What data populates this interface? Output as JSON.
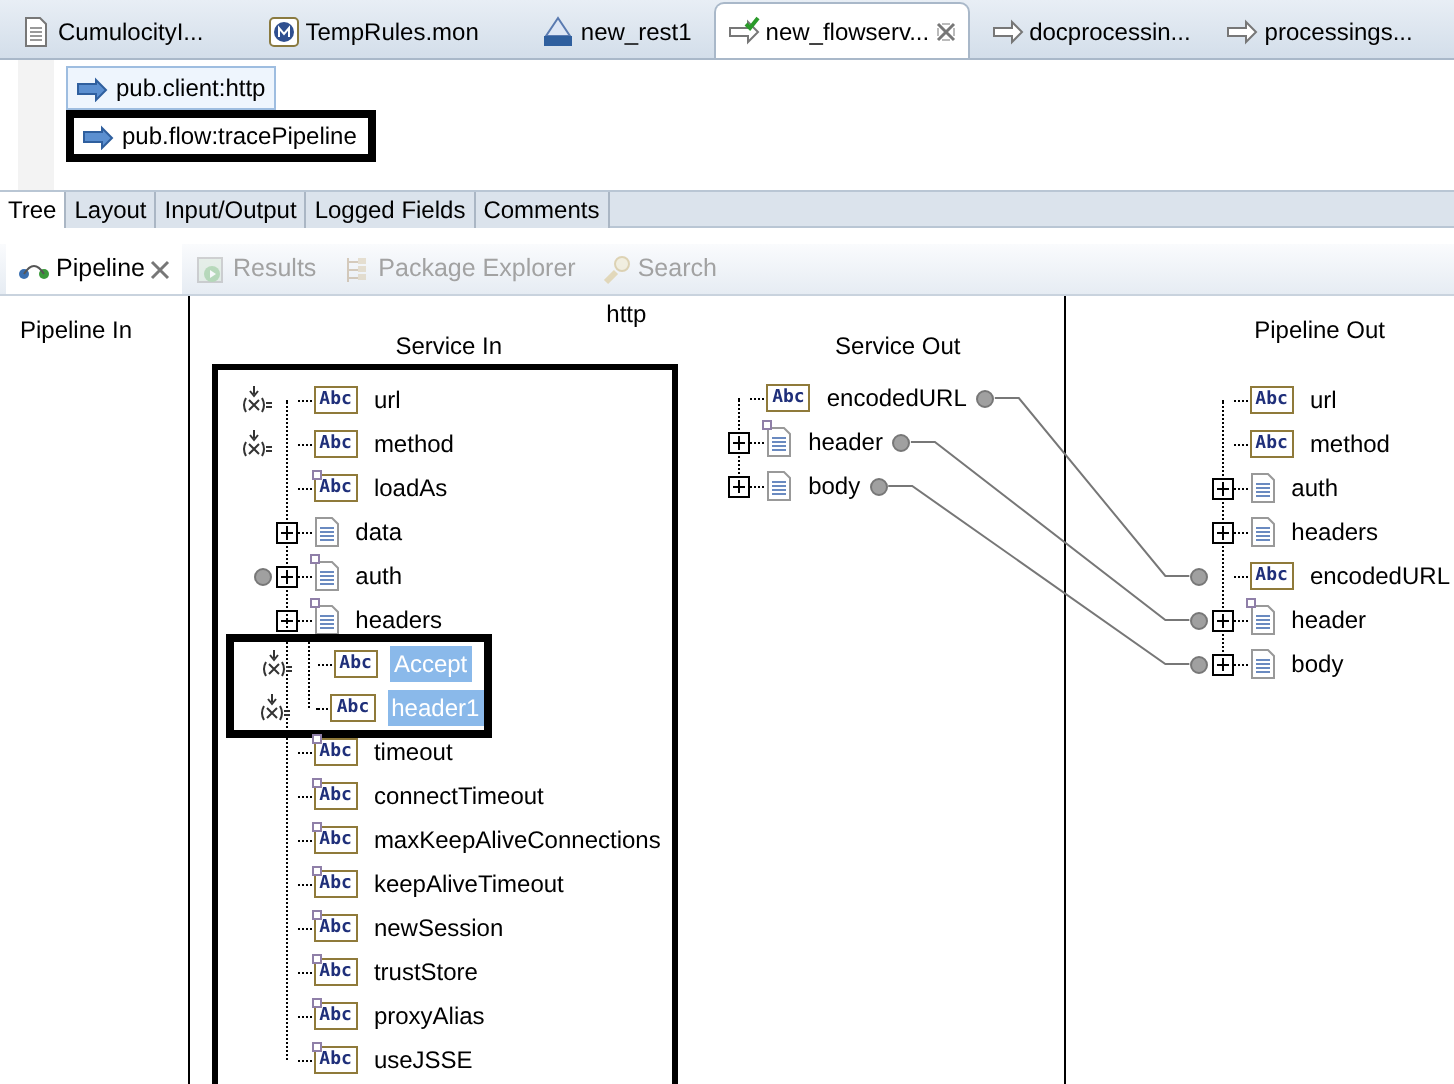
{
  "editor_tabs": [
    {
      "label": "CumulocityI...",
      "kind": "document",
      "selected": false,
      "closable": false
    },
    {
      "label": "TempRules.mon",
      "kind": "monitor",
      "selected": false,
      "closable": false
    },
    {
      "label": "new_rest1",
      "kind": "rest",
      "selected": false,
      "closable": false
    },
    {
      "label": "new_flowserv...",
      "kind": "flow-checked",
      "selected": true,
      "closable": true
    },
    {
      "label": "docprocessin...",
      "kind": "flow",
      "selected": false,
      "closable": false
    },
    {
      "label": "processings...",
      "kind": "flow",
      "selected": false,
      "closable": false
    }
  ],
  "flow_steps": [
    {
      "label": "pub.client:http",
      "selected": true,
      "outlined": false
    },
    {
      "label": "pub.flow:tracePipeline",
      "selected": false,
      "outlined": true
    }
  ],
  "editor_subtabs": [
    {
      "label": "Tree",
      "selected": true
    },
    {
      "label": "Layout",
      "selected": false
    },
    {
      "label": "Input/Output",
      "selected": false
    },
    {
      "label": "Logged Fields",
      "selected": false
    },
    {
      "label": "Comments",
      "selected": false
    }
  ],
  "view_tabs": [
    {
      "label": "Pipeline",
      "kind": "pipeline",
      "selected": true,
      "disabled": false,
      "closable": true
    },
    {
      "label": "Results",
      "kind": "results",
      "selected": false,
      "disabled": true,
      "closable": false
    },
    {
      "label": "Package Explorer",
      "kind": "packages",
      "selected": false,
      "disabled": true,
      "closable": false
    },
    {
      "label": "Search",
      "kind": "search",
      "selected": false,
      "disabled": true,
      "closable": false
    }
  ],
  "pipeline": {
    "pipeline_in": {
      "title": "Pipeline In"
    },
    "service": {
      "title": "http"
    },
    "service_in": {
      "title": "Service In",
      "fields": [
        {
          "name": "url",
          "kind": "string",
          "type_label": "Abc",
          "assigned": true,
          "optional": false
        },
        {
          "name": "method",
          "kind": "string",
          "type_label": "Abc",
          "assigned": true,
          "optional": false
        },
        {
          "name": "loadAs",
          "kind": "string",
          "type_label": "Abc",
          "optional": true
        },
        {
          "name": "data",
          "kind": "document",
          "expanded": false,
          "optional": false
        },
        {
          "name": "auth",
          "kind": "document",
          "expanded": false,
          "optional": true,
          "linked": true
        },
        {
          "name": "headers",
          "kind": "document",
          "expanded": true,
          "optional": true,
          "outlined": true,
          "children": [
            {
              "name": "Accept",
              "kind": "string",
              "type_label": "Abc",
              "assigned": true,
              "optional": false,
              "selected": true
            },
            {
              "name": "header1",
              "kind": "string",
              "type_label": "Abc",
              "assigned": true,
              "optional": false,
              "selected": true
            }
          ]
        },
        {
          "name": "timeout",
          "kind": "string",
          "type_label": "Abc",
          "optional": true
        },
        {
          "name": "connectTimeout",
          "kind": "string",
          "type_label": "Abc",
          "optional": true
        },
        {
          "name": "maxKeepAliveConnections",
          "kind": "string",
          "type_label": "Abc",
          "optional": true
        },
        {
          "name": "keepAliveTimeout",
          "kind": "string",
          "type_label": "Abc",
          "optional": true
        },
        {
          "name": "newSession",
          "kind": "string",
          "type_label": "Abc",
          "optional": true
        },
        {
          "name": "trustStore",
          "kind": "string",
          "type_label": "Abc",
          "optional": true
        },
        {
          "name": "proxyAlias",
          "kind": "string",
          "type_label": "Abc",
          "optional": true
        },
        {
          "name": "useJSSE",
          "kind": "string",
          "type_label": "Abc",
          "optional": true
        }
      ]
    },
    "service_out": {
      "title": "Service Out",
      "fields": [
        {
          "name": "encodedURL",
          "kind": "string",
          "type_label": "Abc",
          "optional": false,
          "linked": true
        },
        {
          "name": "header",
          "kind": "document",
          "expanded": false,
          "optional": true,
          "linked": true
        },
        {
          "name": "body",
          "kind": "document",
          "expanded": false,
          "optional": false,
          "linked": true
        }
      ]
    },
    "pipeline_out": {
      "title": "Pipeline Out",
      "fields": [
        {
          "name": "url",
          "kind": "string",
          "type_label": "Abc",
          "optional": false
        },
        {
          "name": "method",
          "kind": "string",
          "type_label": "Abc",
          "optional": false
        },
        {
          "name": "auth",
          "kind": "document",
          "expanded": false,
          "optional": false
        },
        {
          "name": "headers",
          "kind": "document",
          "expanded": false,
          "optional": false
        },
        {
          "name": "encodedURL",
          "kind": "string",
          "type_label": "Abc",
          "optional": false,
          "linked": true
        },
        {
          "name": "header",
          "kind": "document",
          "expanded": false,
          "optional": true,
          "linked": true
        },
        {
          "name": "body",
          "kind": "document",
          "expanded": false,
          "optional": false,
          "linked": true
        }
      ]
    }
  }
}
